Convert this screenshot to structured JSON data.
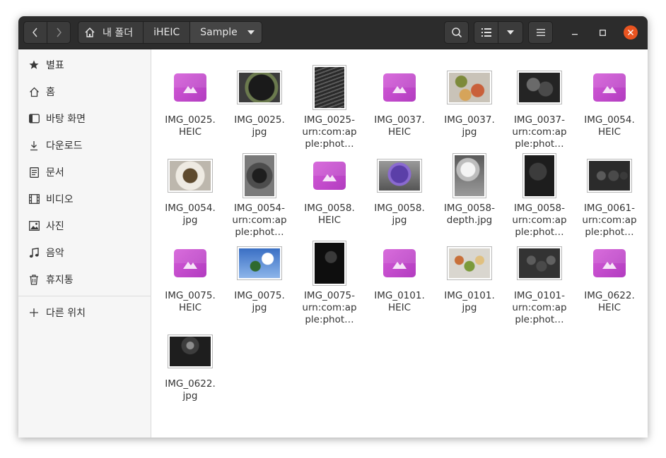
{
  "header": {
    "breadcrumbs": [
      "내 폴더",
      "iHEIC",
      "Sample"
    ]
  },
  "sidebar": {
    "items": [
      {
        "label": "별표",
        "icon": "star-icon"
      },
      {
        "label": "홈",
        "icon": "home-icon"
      },
      {
        "label": "바탕 화면",
        "icon": "desktop-icon"
      },
      {
        "label": "다운로드",
        "icon": "download-icon"
      },
      {
        "label": "문서",
        "icon": "document-icon"
      },
      {
        "label": "비디오",
        "icon": "video-icon"
      },
      {
        "label": "사진",
        "icon": "photo-icon"
      },
      {
        "label": "음악",
        "icon": "music-icon"
      },
      {
        "label": "휴지통",
        "icon": "trash-icon"
      }
    ],
    "other_locations": "다른 위치"
  },
  "files": [
    {
      "l1": "IMG_0025.",
      "l2": "HEIC",
      "l3": ""
    },
    {
      "l1": "IMG_0025.",
      "l2": "jpg",
      "l3": ""
    },
    {
      "l1": "IMG_0025-",
      "l2": "urn:com:ap",
      "l3": "ple:phot…"
    },
    {
      "l1": "IMG_0037.",
      "l2": "HEIC",
      "l3": ""
    },
    {
      "l1": "IMG_0037.",
      "l2": "jpg",
      "l3": ""
    },
    {
      "l1": "IMG_0037-",
      "l2": "urn:com:ap",
      "l3": "ple:phot…"
    },
    {
      "l1": "IMG_0054.",
      "l2": "HEIC",
      "l3": ""
    },
    {
      "l1": "IMG_0054.",
      "l2": "jpg",
      "l3": ""
    },
    {
      "l1": "IMG_0054-",
      "l2": "urn:com:ap",
      "l3": "ple:phot…"
    },
    {
      "l1": "IMG_0058.",
      "l2": "HEIC",
      "l3": ""
    },
    {
      "l1": "IMG_0058.",
      "l2": "jpg",
      "l3": ""
    },
    {
      "l1": "IMG_0058-",
      "l2": "depth.jpg",
      "l3": ""
    },
    {
      "l1": "IMG_0058-",
      "l2": "urn:com:ap",
      "l3": "ple:phot…"
    },
    {
      "l1": "IMG_0061-",
      "l2": "urn:com:ap",
      "l3": "ple:phot…"
    },
    {
      "l1": "IMG_0075.",
      "l2": "HEIC",
      "l3": ""
    },
    {
      "l1": "IMG_0075.",
      "l2": "jpg",
      "l3": ""
    },
    {
      "l1": "IMG_0075-",
      "l2": "urn:com:ap",
      "l3": "ple:phot…"
    },
    {
      "l1": "IMG_0101.",
      "l2": "HEIC",
      "l3": ""
    },
    {
      "l1": "IMG_0101.",
      "l2": "jpg",
      "l3": ""
    },
    {
      "l1": "IMG_0101-",
      "l2": "urn:com:ap",
      "l3": "ple:phot…"
    },
    {
      "l1": "IMG_0622.",
      "l2": "HEIC",
      "l3": ""
    },
    {
      "l1": "IMG_0622.",
      "l2": "jpg",
      "l3": ""
    }
  ]
}
